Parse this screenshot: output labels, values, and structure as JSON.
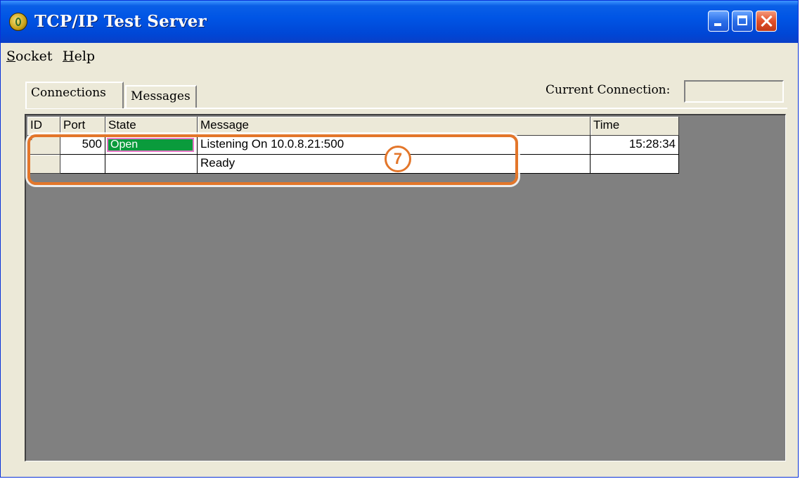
{
  "window": {
    "title": "TCP/IP Test Server",
    "icon": "app-globe-icon"
  },
  "title_buttons": {
    "minimize": "minimize-icon",
    "maximize": "maximize-icon",
    "close": "close-icon"
  },
  "menu": {
    "socket": {
      "mnemonic": "S",
      "rest": "ocket"
    },
    "help": {
      "mnemonic": "H",
      "rest": "elp"
    }
  },
  "tabs": {
    "connections": "Connections",
    "messages": "Messages"
  },
  "current_connection": {
    "label": "Current Connection:",
    "value": ""
  },
  "table": {
    "headers": {
      "id": "ID",
      "port": "Port",
      "state": "State",
      "message": "Message",
      "time": "Time"
    },
    "rows": [
      {
        "id": "*",
        "port": "500",
        "state": "Open",
        "message": "Listening On 10.0.8.21:500",
        "time": "15:28:34"
      },
      {
        "id": "",
        "port": "",
        "state": "",
        "message": "Ready",
        "time": ""
      }
    ]
  },
  "annotation": {
    "number": "7"
  },
  "colors": {
    "highlight": "#e3762a",
    "state_open_bg": "#0a9b3c",
    "state_open_border": "#e879c9",
    "titlebar": "#0055e5",
    "grid_bg": "#808080"
  }
}
